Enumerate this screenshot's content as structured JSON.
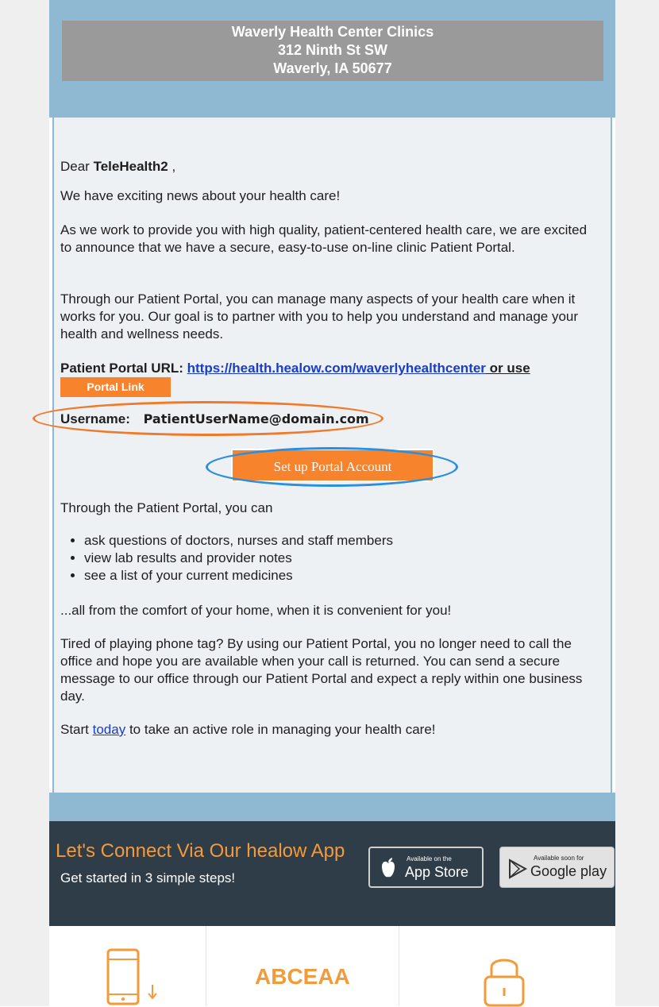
{
  "header": {
    "line1": "Waverly Health Center Clinics",
    "line2": "312 Ninth St SW",
    "line3": "Waverly, IA 50677"
  },
  "letter": {
    "dear": "Dear ",
    "patient_name": "TeleHealth2",
    "dear_suffix": " ,",
    "p1": "We have exciting news about your health care!",
    "p2": "As we work to provide you with high quality, patient-centered health care, we are excited to announce that we have a secure, easy-to-use on-line clinic Patient Portal.",
    "p3": "Through our Patient Portal, you can manage many aspects of your health care when it works for you. Our goal is to partner with you to help you understand and manage your health and wellness needs.",
    "portal_url_label": "Patient Portal URL: ",
    "portal_url": "https://health.healow.com/waverlyhealthcenter",
    "or_use": " or use",
    "portal_link_button": "Portal Link",
    "username_label": "Username:",
    "username_value": "PatientUserName@domain.com",
    "setup_button": "Set up Portal Account",
    "p4": "Through the Patient Portal, you can",
    "bullets": [
      "ask questions of doctors, nurses and staff members",
      "view lab results and provider notes",
      "see a list of your current medicines"
    ],
    "p5": "...all from the comfort of your home, when it is convenient for you!",
    "p6": "Tired of playing phone tag? By using our Patient Portal, you no longer need to call the office and hope you are available when your call is returned. You can send a secure message to our office through our Patient Portal and expect a reply within one business day.",
    "p7_start": "Start ",
    "p7_link": "today",
    "p7_end": " to take an active role in managing your health care!"
  },
  "app_section": {
    "title": "Let's Connect Via Our healow App",
    "subtitle": "Get started in 3 simple steps!",
    "appstore_small": "Available on the",
    "appstore_big": "App Store",
    "gplay_small": "Available soon for",
    "gplay_big": "Google play"
  },
  "steps": {
    "code": "ABCEAA",
    "icons": [
      "phone-download-icon",
      "lock-icon"
    ]
  },
  "colors": {
    "header_band": "#8fb9d3",
    "header_box": "#9a9a9a",
    "accent_orange": "#f7832d",
    "highlight_blue": "#2a8fe0",
    "app_band": "#2f3d49"
  }
}
